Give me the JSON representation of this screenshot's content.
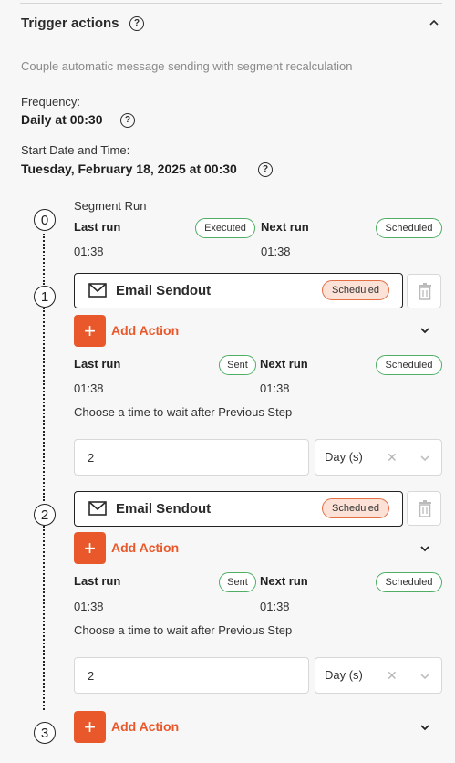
{
  "header": {
    "title": "Trigger actions",
    "subtitle": "Couple automatic message sending with segment recalculation"
  },
  "frequency": {
    "label": "Frequency:",
    "value": "Daily at 00:30"
  },
  "start": {
    "label": "Start Date and Time:",
    "value": "Tuesday, February 18, 2025 at 00:30"
  },
  "icons": {
    "help": "?",
    "plus": "+",
    "clear": "✕"
  },
  "steps": [
    {
      "number": "0",
      "title": "Segment Run",
      "last_run_label": "Last run",
      "last_run_badge": "Executed",
      "last_run_time": "01:38",
      "next_run_label": "Next run",
      "next_run_badge": "Scheduled",
      "next_run_time": "01:38"
    },
    {
      "number": "1",
      "action_label": "Email Sendout",
      "action_badge": "Scheduled",
      "add_action_label": "Add Action",
      "last_run_label": "Last run",
      "last_run_badge": "Sent",
      "last_run_time": "01:38",
      "next_run_label": "Next run",
      "next_run_badge": "Scheduled",
      "next_run_time": "01:38",
      "wait_label": "Choose a time to wait after Previous Step",
      "wait_value": "2",
      "wait_unit": "Day (s)"
    },
    {
      "number": "2",
      "action_label": "Email Sendout",
      "action_badge": "Scheduled",
      "add_action_label": "Add Action",
      "last_run_label": "Last run",
      "last_run_badge": "Sent",
      "last_run_time": "01:38",
      "next_run_label": "Next run",
      "next_run_badge": "Scheduled",
      "next_run_time": "01:38",
      "wait_label": "Choose a time to wait after Previous Step",
      "wait_value": "2",
      "wait_unit": "Day (s)"
    },
    {
      "number": "3",
      "add_action_label": "Add Action"
    }
  ]
}
